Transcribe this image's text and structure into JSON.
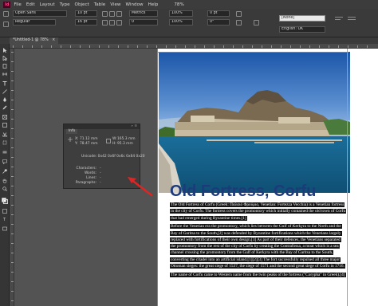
{
  "menubar": {
    "logo": "Id",
    "items": [
      "File",
      "Edit",
      "Layout",
      "Type",
      "Object",
      "Table",
      "View",
      "Window",
      "Help"
    ],
    "zoom": "78%"
  },
  "control": {
    "font_family": "Open Sans",
    "font_style": "Regular",
    "font_size": "10 pt",
    "leading": "16 pt",
    "kerning": "Metrics",
    "tracking": "0",
    "scale_v": "100%",
    "scale_h": "100%",
    "baseline": "0 pt",
    "skew": "0°",
    "char_style": "[None]",
    "language": "English: UK"
  },
  "document_tab": {
    "label": "*Untitled-1 @ 78%",
    "close": "×"
  },
  "info_panel": {
    "title": "Info",
    "x_label": "X:",
    "y_label": "Y:",
    "w_label": "W:",
    "w_value": "165.3 mm",
    "h_label": "H:",
    "h_value": "95.3 mm",
    "x_value": "71.12 mm",
    "y_value": "78.47 mm",
    "unicode_label": "Unicode: 0x42 0x6f 0x6c 0x64 0x20",
    "characters_label": "Characters:",
    "characters_value": "-",
    "words_label": "Words:",
    "words_value": "-",
    "lines_label": "Lines:",
    "lines_value": "-",
    "paragraphs_label": "Paragraphs:",
    "paragraphs_value": "-"
  },
  "page": {
    "title": "Old Fortress, Corfu",
    "paragraphs": [
      "The Old Fortress of Corfu (Greek: Παλαιό Φρούριο, Venetian: Fortezza Vecchia) is a Venetian fortress in the city of Corfu. The fortress covers the promontory which initially contained the old town of Corfu that had emerged during Byzantine times.[1]",
      "Before the Venetian era the promontory, which lies between the Gulf of Kerkyra to the North and the Bay of Garitsa to the South,[2] was defended by Byzantine fortifications which the Venetians largely replaced with fortifications of their own design.[3] As part of their defences, the Venetians separated the promontory from the rest of the city of Corfu by creating the Contrafossa, a moat which is a sea channel crossing the promontory from the Gulf of Kerkyra with the Bay of Garitsa to the South, converting the citadel into an artificial island.[1][2][3] The fort successfully repulsed all three major Ottoman sieges: the great siege of 1537, the siege of 1571 and the second great siege of Corfu in 1716.",
      "The name of Corfu came to Western name from the twin peaks of the fortress (\"Corypha\" in Greek).[4]"
    ]
  },
  "colors": {
    "title": "#1d3b7a",
    "highlight": "#121212",
    "arrow": "#e02424",
    "guide": "#d74fd1"
  }
}
